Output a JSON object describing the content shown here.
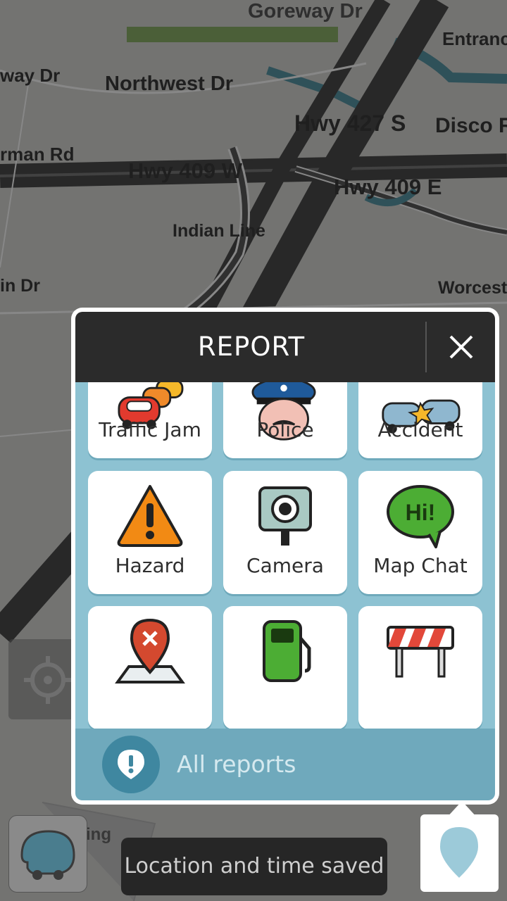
{
  "map": {
    "road_labels": [
      "Goreway Dr",
      "Entranc",
      "way Dr",
      "Northwest Dr",
      "Hwy 427 S",
      "Disco R",
      "rman Rd",
      "Hwy 409 W",
      "Hwy 409 E",
      "Indian Line",
      "in Dr",
      "Worcest",
      "ing"
    ]
  },
  "report_panel": {
    "title": "REPORT",
    "close_icon": "close-icon",
    "items": [
      {
        "label": "Traffic Jam",
        "icon": "traffic-jam-icon"
      },
      {
        "label": "Police",
        "icon": "police-icon"
      },
      {
        "label": "Accident",
        "icon": "accident-icon"
      },
      {
        "label": "Hazard",
        "icon": "hazard-icon"
      },
      {
        "label": "Camera",
        "icon": "camera-icon"
      },
      {
        "label": "Map Chat",
        "icon": "map-chat-icon"
      },
      {
        "label": "",
        "icon": "map-issue-icon"
      },
      {
        "label": "",
        "icon": "gas-station-icon"
      },
      {
        "label": "",
        "icon": "road-closure-icon"
      }
    ],
    "map_chat_bubble_text": "Hi!",
    "all_reports_label": "All reports",
    "all_reports_icon": "alert-pin-icon"
  },
  "bottom_bar": {
    "toast_text": "Location and time saved",
    "waze_icon": "waze-menu-icon",
    "report_icon": "report-pin-icon",
    "recenter_icon": "recenter-icon"
  },
  "colors": {
    "header_bg": "#2b2b2b",
    "grid_bg": "#8dc2d2",
    "all_reports_bg": "#6fa9bc",
    "toast_bg": "#262626"
  }
}
